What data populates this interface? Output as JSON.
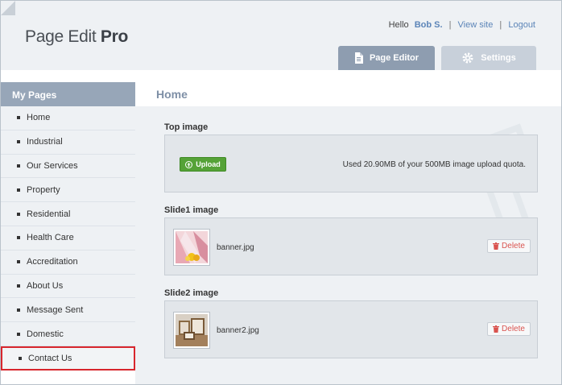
{
  "app": {
    "logo_regular": "Page Edit ",
    "logo_bold": "Pro"
  },
  "topnav": {
    "hello": "Hello",
    "user": "Bob S.",
    "sep1": "|",
    "view_site": "View site",
    "sep2": "|",
    "logout": "Logout"
  },
  "tabs": [
    {
      "label": "Page Editor",
      "icon": "document-icon",
      "active": true
    },
    {
      "label": "Settings",
      "icon": "gear-icon",
      "active": false
    }
  ],
  "sidebar": {
    "heading": "My Pages",
    "items": [
      {
        "label": "Home"
      },
      {
        "label": "Industrial"
      },
      {
        "label": "Our Services"
      },
      {
        "label": "Property"
      },
      {
        "label": "Residential"
      },
      {
        "label": "Health Care"
      },
      {
        "label": "Accreditation"
      },
      {
        "label": "About Us"
      },
      {
        "label": "Message Sent"
      },
      {
        "label": "Domestic"
      },
      {
        "label": "Contact Us",
        "highlighted": true
      }
    ]
  },
  "main": {
    "page_title": "Home",
    "top_image": {
      "label": "Top image",
      "upload_label": "Upload",
      "quota_text": "Used 20.90MB of your 500MB image upload quota."
    },
    "slide1": {
      "label": "Slide1 image",
      "filename": "banner.jpg",
      "delete_label": "Delete"
    },
    "slide2": {
      "label": "Slide2 image",
      "filename": "banner2.jpg",
      "delete_label": "Delete"
    }
  },
  "colors": {
    "accent": "#8e9db0",
    "link": "#5c85b8",
    "upload": "#55a237",
    "delete": "#d9534f",
    "highlight_border": "#d8262d"
  }
}
